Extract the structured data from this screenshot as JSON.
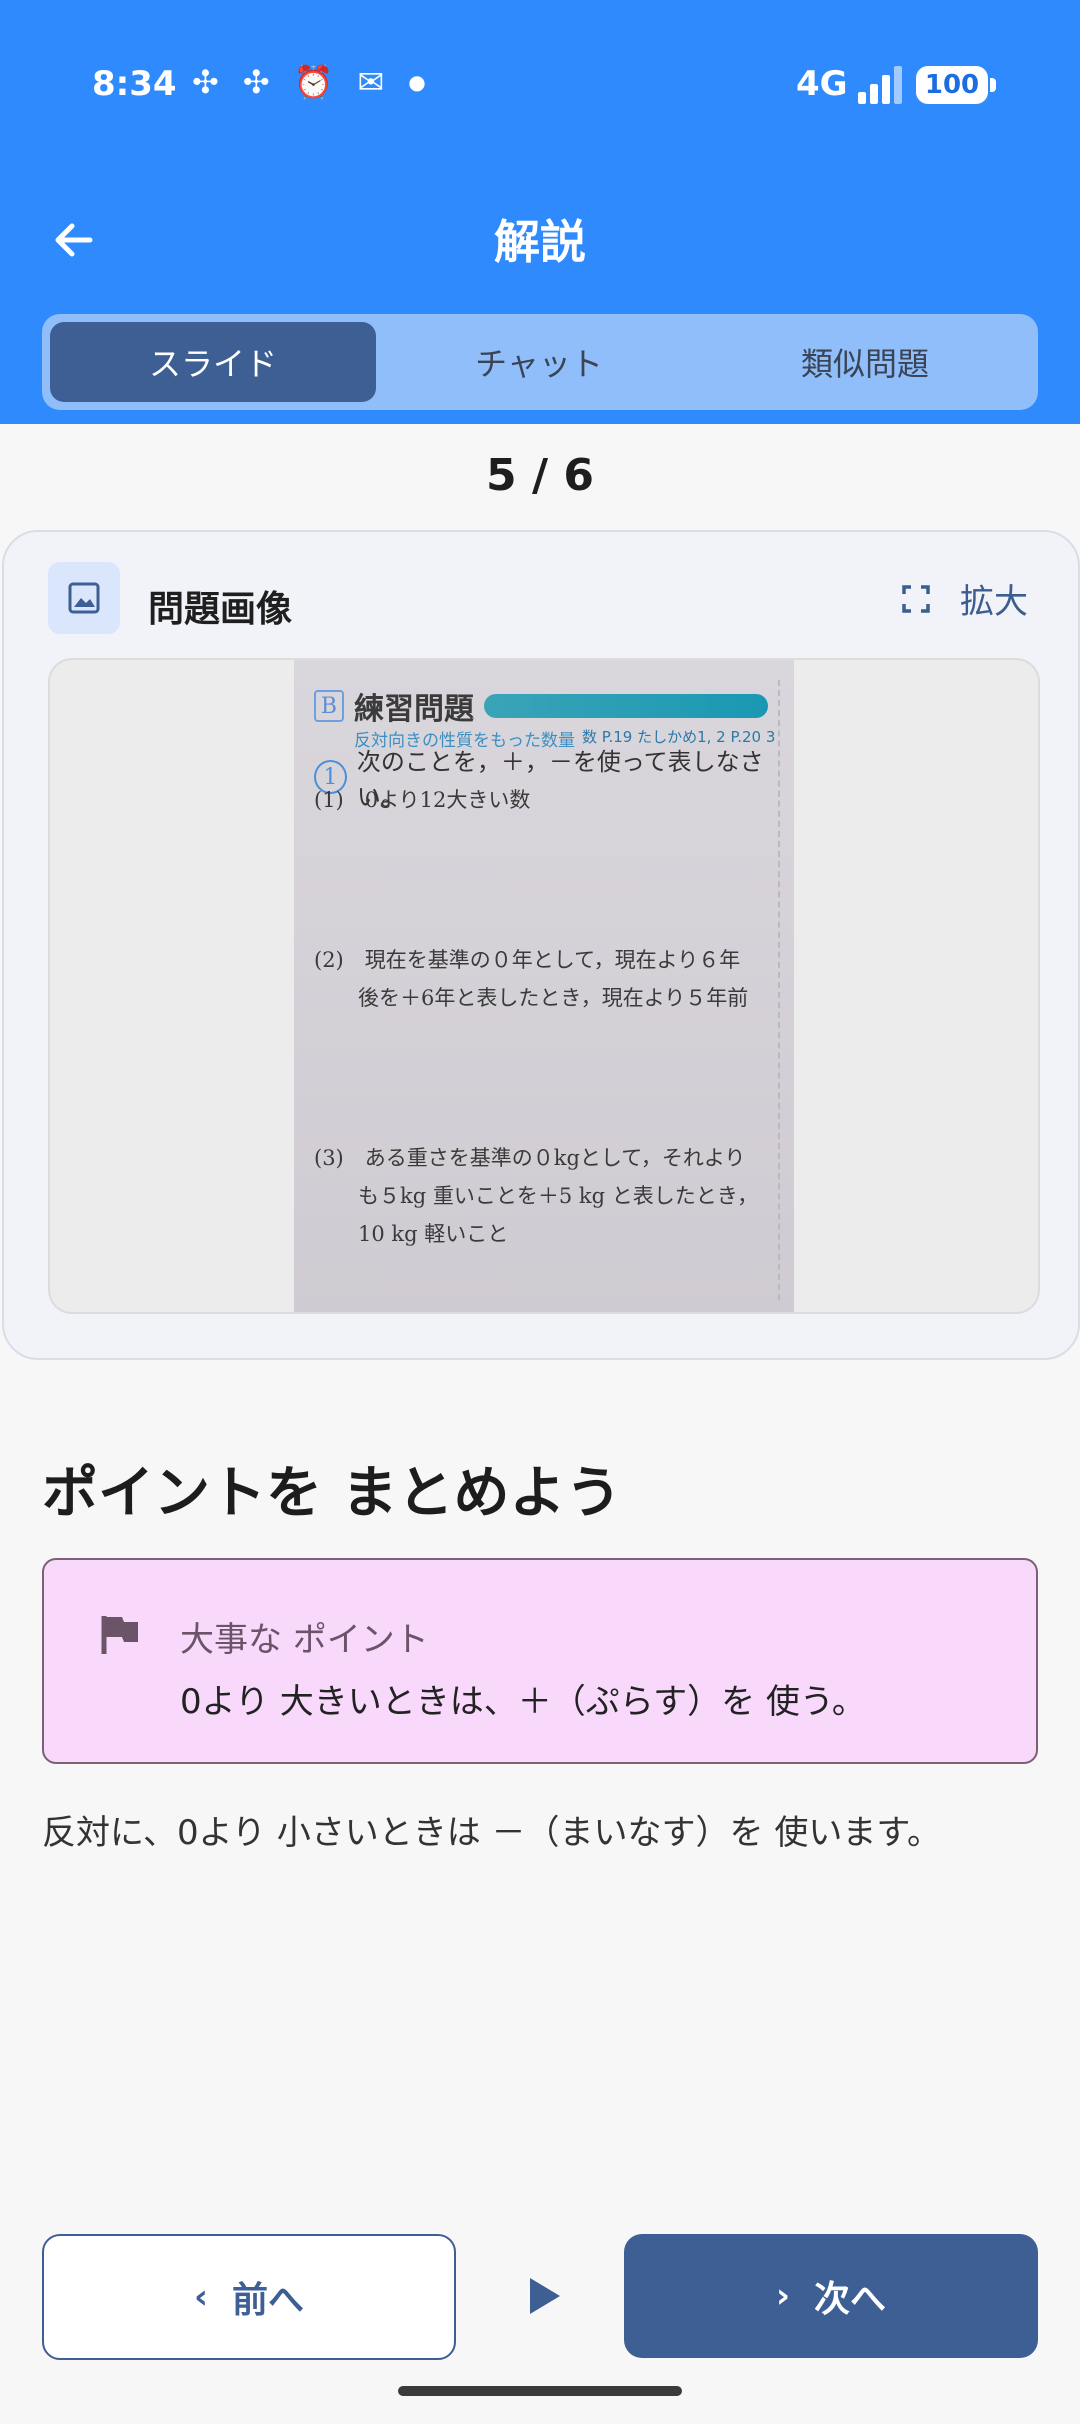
{
  "status_bar": {
    "time": "8:34",
    "network": "4G",
    "battery": "100",
    "icons": [
      "slack-icon",
      "slack-icon",
      "alarm-icon",
      "gmail-icon",
      "dot-icon"
    ]
  },
  "header": {
    "title": "解説",
    "tabs": [
      {
        "label": "スライド",
        "active": true
      },
      {
        "label": "チャット",
        "active": false
      },
      {
        "label": "類似問題",
        "active": false
      }
    ]
  },
  "pager": {
    "counter": "5 / 6"
  },
  "image_card": {
    "title": "問題画像",
    "expand_label": "拡大",
    "photo": {
      "heading": "練習問題",
      "badge": "B",
      "subheading": "反対向きの性質をもった数量",
      "reference": "数 P.19 たしかめ1, 2 P.20 3",
      "q_number": "1",
      "instruction": "次のことを，＋，－を使って表しなさい。",
      "items": [
        "(1)　0より12大きい数",
        "(2)　現在を基準の０年として，現在より６年",
        "後を＋6年と表したとき，現在より５年前",
        "(3)　ある重さを基準の０kgとして，それより",
        "も５kg 重いことを＋5 kg と表したとき，",
        "10 kg 軽いこと"
      ]
    }
  },
  "summary": {
    "title": "ポイントを まとめよう",
    "point_label": "大事な ポイント",
    "point_text": "0より 大きいときは、＋（ぷらす）を 使う。",
    "body": "反対に、0より 小さいときは －（まいなす）を 使います。"
  },
  "navigation": {
    "prev_label": "前へ",
    "next_label": "次へ"
  },
  "colors": {
    "header_blue": "#2f8bfd",
    "navy": "#3e5f93",
    "point_bg": "#f8d8fb"
  }
}
